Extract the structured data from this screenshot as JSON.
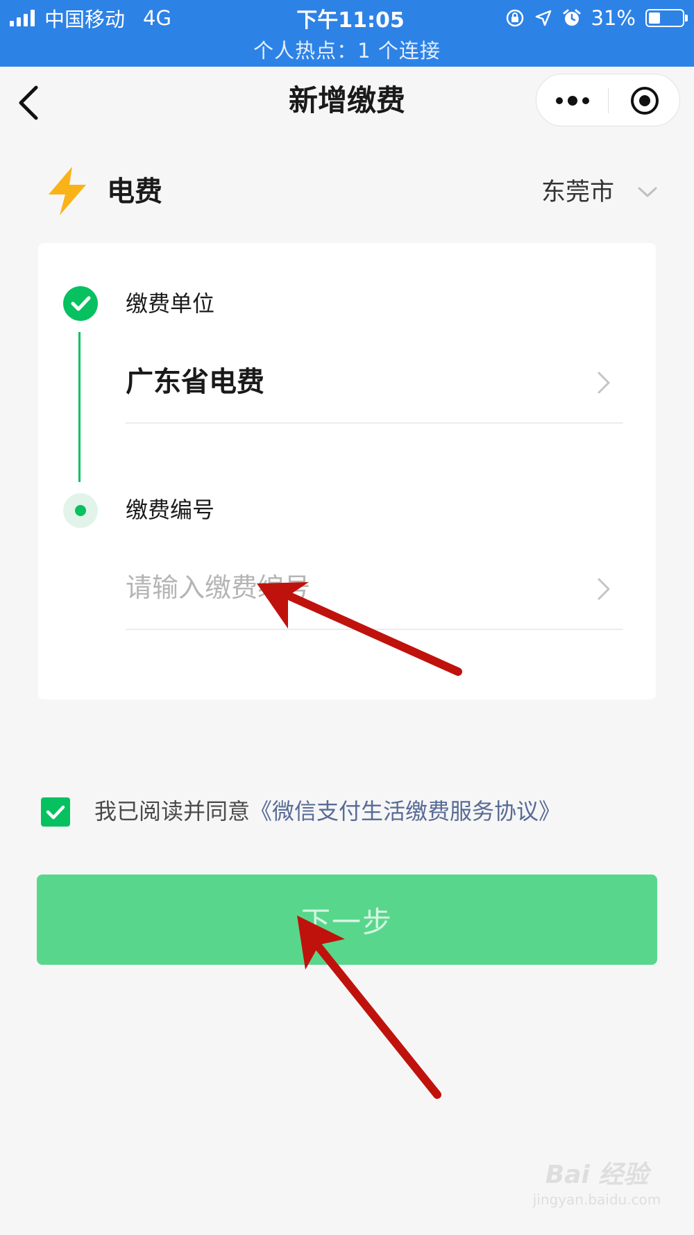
{
  "status_bar": {
    "carrier": "中国移动",
    "network": "4G",
    "time": "下午11:05",
    "battery": "31%",
    "hotspot": "个人热点：1 个连接"
  },
  "nav": {
    "title": "新增缴费",
    "back_icon": "chevron-left-icon",
    "more_icon": "more-dots-icon",
    "close_icon": "target-circle-icon"
  },
  "category": {
    "icon": "lightning-bolt-icon",
    "label": "电费",
    "city": "东莞市"
  },
  "form": {
    "step1": {
      "title": "缴费单位",
      "value": "广东省电费"
    },
    "step2": {
      "title": "缴费编号",
      "placeholder": "请输入缴费编号",
      "value": ""
    }
  },
  "agreement": {
    "checked": true,
    "text": "我已阅读并同意",
    "link": "《微信支付生活缴费服务协议》"
  },
  "next_button": {
    "label": "下一步"
  },
  "watermark": {
    "main": "Bai 经验",
    "sub": "jingyan.baidu.com"
  },
  "colors": {
    "status_bar": "#2d82e6",
    "accent_green": "#07c160",
    "button_green": "#58d78c",
    "link": "#576b95",
    "annotation_arrow": "#c0120c"
  }
}
